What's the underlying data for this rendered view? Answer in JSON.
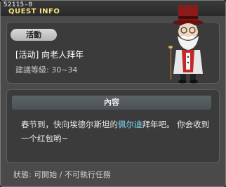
{
  "window": {
    "quest_id": "52115-0",
    "title": "QUEST INFO"
  },
  "quest": {
    "category": "活動",
    "name": "[活动] 向老人拜年",
    "level_req": "建議等級: 30~34"
  },
  "content": {
    "header": "內容",
    "description_before": "春节到，快向埃德尔斯坦的",
    "npc_name": "佩尔迪",
    "description_after": "拜年吧。 你会收到一个红包哟~"
  },
  "status": {
    "text": "狀態: 可開始 / 不可執行任務"
  },
  "colors": {
    "title": "#f4e37c",
    "highlight": "#7fe0ff",
    "hat": "#8b1a1a"
  }
}
